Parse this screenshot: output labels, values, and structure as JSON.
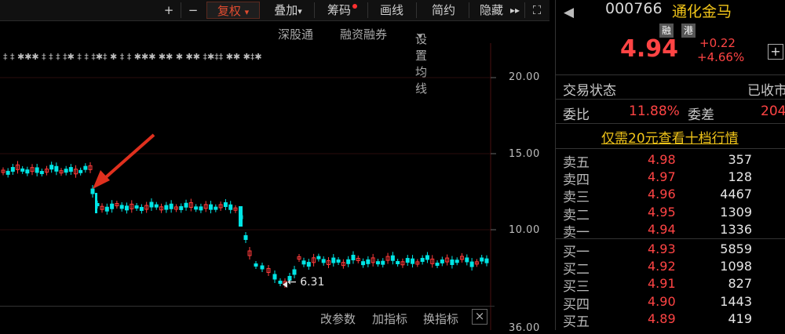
{
  "toolbar": {
    "plus": "+",
    "minus": "−",
    "fuquan": "复权",
    "fuquan_arrow": "▾",
    "diejia": "叠加",
    "chouma": "筹码",
    "huaxian": "画线",
    "jianyue": "简约",
    "yincang": "隐藏",
    "more": "▸▸",
    "fullscreen": "⛶"
  },
  "subtoolbar": {
    "shengutong": "深股通",
    "rongzirongquan": "融资融券",
    "shezhijunxian": "设置均线",
    "arrow": "▾"
  },
  "chart": {
    "y_ticks": [
      "20.00",
      "15.00",
      "10.00",
      "36.00"
    ],
    "low_label": "6.31",
    "low_arrow": "←",
    "colors": {
      "up": "#ff3b3b",
      "down": "#00e5e5",
      "annotation": "#e0301e"
    }
  },
  "bottom": {
    "gaicanshu": "改参数",
    "jiazhibiao": "加指标",
    "huanzhibiao": "换指标",
    "close": "×"
  },
  "quote": {
    "back_arrow": "◀",
    "code": "000766",
    "name": "通化金马",
    "badge_rong": "融",
    "badge_gang": "港",
    "price": "4.94",
    "change": "+0.22",
    "change_pct": "+4.66%",
    "add": "+",
    "jiaoyi_label": "交易状态",
    "jiaoyi_value": "已收市",
    "weibi_label": "委比",
    "weibi_value": "11.88%",
    "weicha_label": "委差",
    "weicha_value": "204",
    "promo": "仅需20元查看十档行情"
  },
  "order_book": {
    "asks": [
      {
        "label": "卖五",
        "price": "4.98",
        "volume": "357"
      },
      {
        "label": "卖四",
        "price": "4.97",
        "volume": "128"
      },
      {
        "label": "卖三",
        "price": "4.96",
        "volume": "4467"
      },
      {
        "label": "卖二",
        "price": "4.95",
        "volume": "1309"
      },
      {
        "label": "卖一",
        "price": "4.94",
        "volume": "1336"
      }
    ],
    "bids": [
      {
        "label": "买一",
        "price": "4.93",
        "volume": "5859"
      },
      {
        "label": "买二",
        "price": "4.92",
        "volume": "1098"
      },
      {
        "label": "买三",
        "price": "4.91",
        "volume": "827"
      },
      {
        "label": "买四",
        "price": "4.90",
        "volume": "1443"
      },
      {
        "label": "买五",
        "price": "4.89",
        "volume": "419"
      }
    ]
  }
}
